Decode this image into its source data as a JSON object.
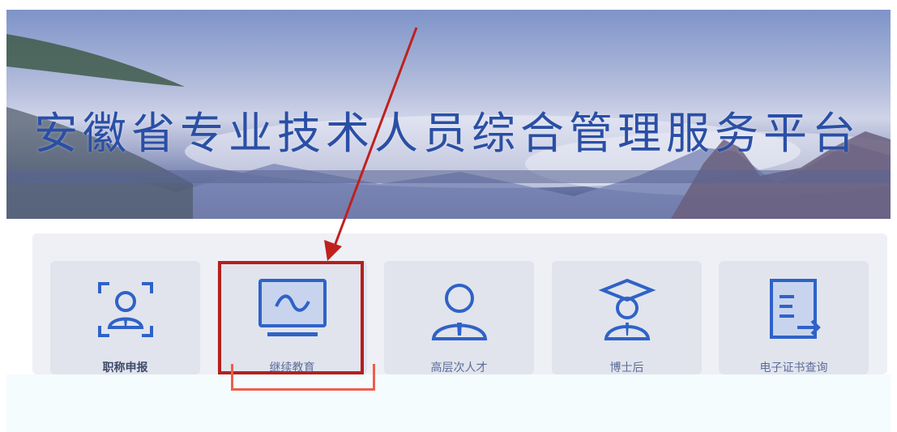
{
  "header": {
    "title": "安徽省专业技术人员综合管理服务平台"
  },
  "cards": [
    {
      "label": "职称申报",
      "icon": "user-frame-icon"
    },
    {
      "label": "继续教育",
      "icon": "monitor-wave-icon"
    },
    {
      "label": "高层次人才",
      "icon": "person-tie-icon"
    },
    {
      "label": "博士后",
      "icon": "graduate-cap-icon"
    },
    {
      "label": "电子证书查询",
      "icon": "document-arrow-icon"
    }
  ],
  "colors": {
    "accent": "#2a4fa5",
    "icon": "#2f62c8",
    "highlight": "#b51f1f",
    "highlight_light": "#ef5e4c"
  }
}
